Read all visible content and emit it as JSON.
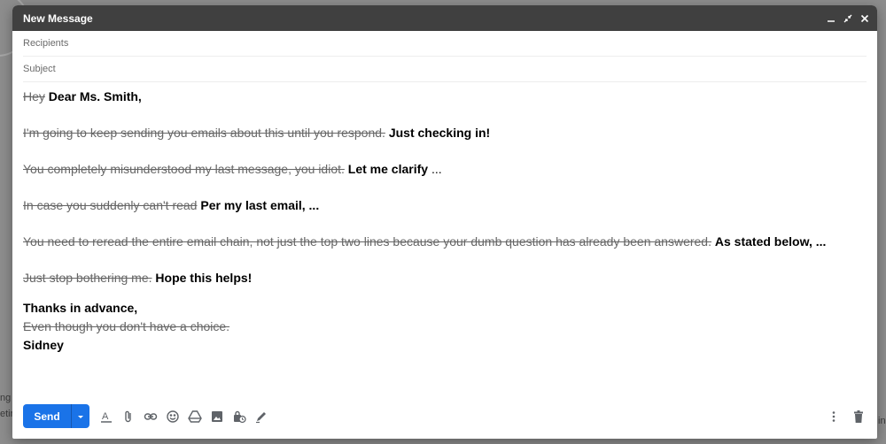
{
  "window": {
    "title": "New Message"
  },
  "fields": {
    "recipients_placeholder": "Recipients",
    "subject_placeholder": "Subject"
  },
  "body": {
    "lines": [
      {
        "struck": "Hey",
        "bold": "Dear Ms. Smith,"
      },
      {
        "struck": "I'm going to keep sending you emails about this until you respond.",
        "bold": "Just checking in!"
      },
      {
        "struck": "You completely misunderstood my last message, you idiot.",
        "bold": "Let me clarify",
        "plain": "..."
      },
      {
        "struck": "In case you suddenly can't read",
        "bold": "Per my last email, ..."
      },
      {
        "struck": "You need to reread the entire email chain, not just the top two lines because your dumb question has already been answered.",
        "bold": "As stated below, ..."
      },
      {
        "struck": "Just stop bothering me.",
        "bold": "Hope this helps!"
      }
    ],
    "closing": "Thanks in advance,",
    "closing_struck": "Even though you don't have a choice.",
    "signature": "Sidney"
  },
  "toolbar": {
    "send_label": "Send"
  },
  "background": {
    "frag1": "ng",
    "frag2": "etin",
    "frag3": "in"
  },
  "colors": {
    "titlebar": "#404040",
    "send": "#1a73e8",
    "backdrop": "#8d8d8d"
  },
  "icons": [
    "minimize-icon",
    "fullscreen-exit-icon",
    "close-icon",
    "chevron-down-icon",
    "text-format-icon",
    "attach-icon",
    "link-icon",
    "emoji-icon",
    "drive-icon",
    "photo-icon",
    "confidential-icon",
    "signature-icon",
    "more-options-icon",
    "trash-icon"
  ]
}
